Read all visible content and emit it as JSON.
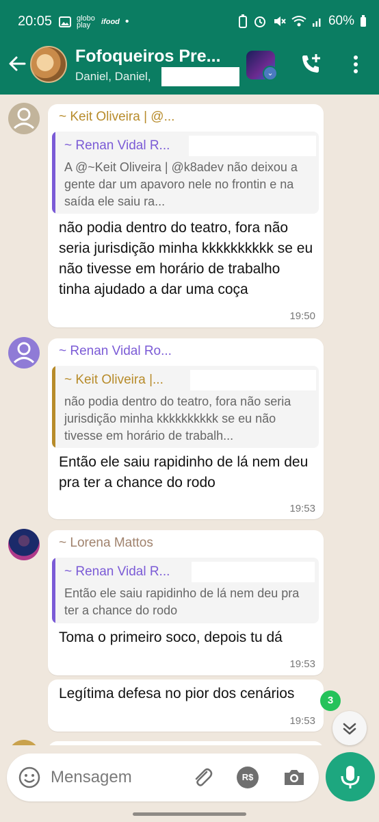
{
  "status_bar": {
    "time": "20:05",
    "left_apps": [
      "globo play",
      "ifood"
    ],
    "battery": "60%"
  },
  "header": {
    "title": "Fofoqueiros Pre...",
    "members": "Daniel, Daniel,"
  },
  "messages": [
    {
      "sender": "~ Keit Oliveira | @...",
      "sender_color": "#b78b2a",
      "avatar": "default-avatar",
      "quote_sender": "~ Renan Vidal R...",
      "quote_color": "#7b5bd6",
      "quote_text": "A @~Keit Oliveira | @k8adev não deixou a gente dar um apavoro nele no frontin e na saída ele saiu ra...",
      "text": "não podia dentro do teatro, fora não seria jurisdição minha kkkkkkkkkk se eu não tivesse em horário de trabalho tinha ajudado a dar uma coça",
      "time": "19:50"
    },
    {
      "sender": "~ Renan Vidal Ro...",
      "sender_color": "#7b5bd6",
      "avatar": "default-avatar",
      "quote_sender": "~ Keit Oliveira |...",
      "quote_color": "#b78b2a",
      "quote_text": "não podia dentro do teatro, fora não seria jurisdição minha kkkkkkkkkk se eu não tivesse em horário de trabalh...",
      "text": "Então ele saiu rapidinho de lá nem deu pra ter a chance do rodo",
      "time": "19:53"
    },
    {
      "sender": "~ Lorena Mattos",
      "sender_color": "#a0826d",
      "avatar": "photo-avatar",
      "quote_sender": "~ Renan Vidal R...",
      "quote_color": "#7b5bd6",
      "quote_text": "Então ele saiu rapidinho de lá nem deu pra ter a chance do rodo",
      "text": "Toma o primeiro soco, depois tu dá",
      "time": "19:53"
    },
    {
      "text": "Legítima defesa no pior dos cenários",
      "time": "19:53"
    }
  ],
  "unread_count": "3",
  "composer": {
    "placeholder": "Mensagem",
    "pay_label": "R$"
  }
}
